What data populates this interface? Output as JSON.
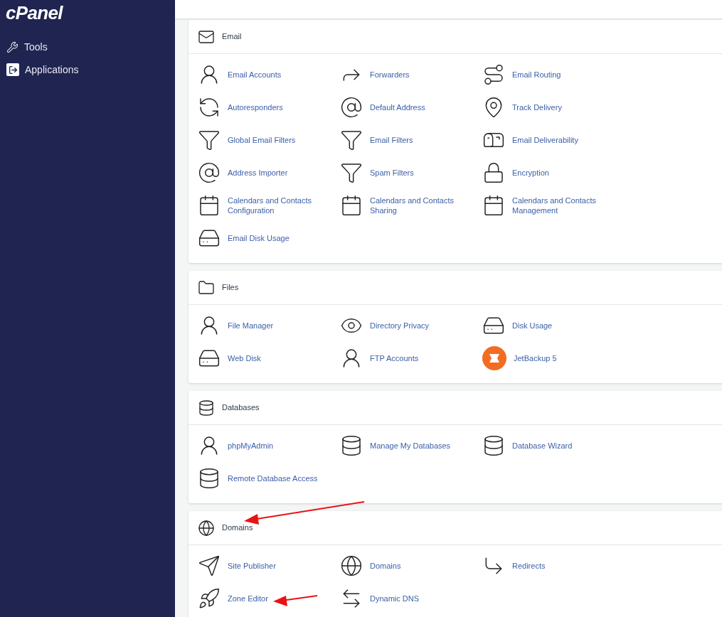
{
  "sidebar": {
    "logo": "cPanel",
    "items": [
      {
        "label": "Tools"
      },
      {
        "label": "Applications"
      }
    ]
  },
  "sections": [
    {
      "title": "Email",
      "items": [
        "Email Accounts",
        "Forwarders",
        "Email Routing",
        "Autoresponders",
        "Default Address",
        "Track Delivery",
        "Global Email Filters",
        "Email Filters",
        "Email Deliverability",
        "Address Importer",
        "Spam Filters",
        "Encryption",
        "Calendars and Contacts Configuration",
        "Calendars and Contacts Sharing",
        "Calendars and Contacts Management",
        "Email Disk Usage"
      ]
    },
    {
      "title": "Files",
      "items": [
        "File Manager",
        "Directory Privacy",
        "Disk Usage",
        "Web Disk",
        "FTP Accounts",
        "JetBackup 5"
      ]
    },
    {
      "title": "Databases",
      "items": [
        "phpMyAdmin",
        "Manage My Databases",
        "Database Wizard",
        "Remote Database Access"
      ]
    },
    {
      "title": "Domains",
      "items": [
        "Site Publisher",
        "Domains",
        "Redirects",
        "Zone Editor",
        "Dynamic DNS"
      ]
    }
  ]
}
